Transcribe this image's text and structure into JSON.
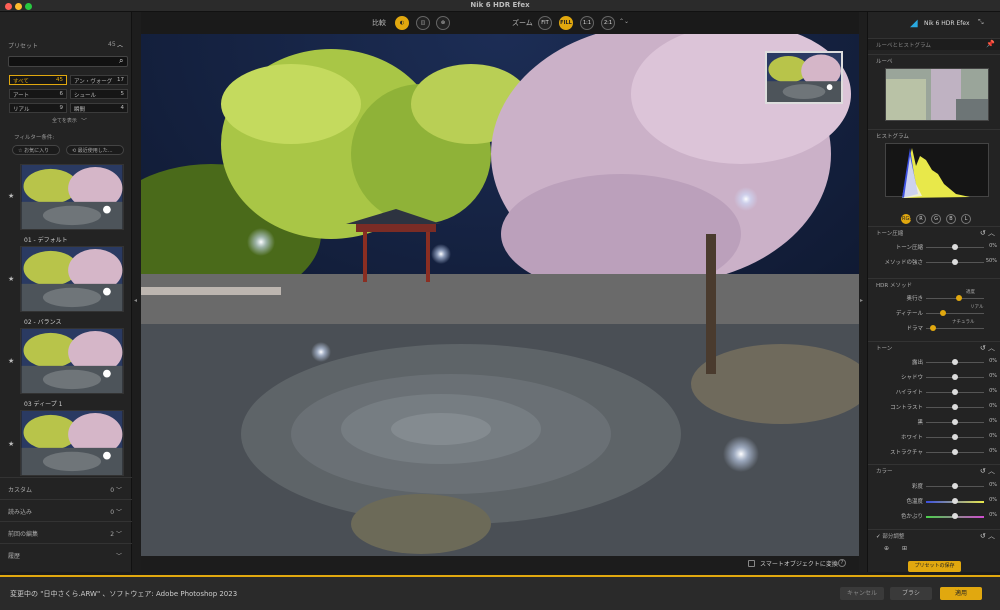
{
  "window": {
    "title": "Nik 6 HDR Efex"
  },
  "left": {
    "presets_label": "プリセット",
    "presets_count": "45",
    "categories": [
      {
        "label": "すべて",
        "count": "45",
        "sel": true
      },
      {
        "label": "アン・ヴォーグ",
        "count": "17"
      },
      {
        "label": "アート",
        "count": "6"
      },
      {
        "label": "シュール",
        "count": "5"
      },
      {
        "label": "リアル",
        "count": "9"
      },
      {
        "label": "瞬間",
        "count": "4"
      }
    ],
    "show_all": "全てを表示",
    "filter_label": "フィルター条件:",
    "favorites": "お気に入り",
    "recent": "最近使用した...",
    "thumbs": [
      {
        "label": "01 - デフォルト"
      },
      {
        "label": "02 - バランス"
      },
      {
        "label": "03 ディープ 1"
      },
      {
        "label": ""
      }
    ],
    "sections": [
      {
        "label": "カスタム",
        "count": "0"
      },
      {
        "label": "読み込み",
        "count": "0"
      },
      {
        "label": "前回の編集",
        "count": "2"
      },
      {
        "label": "履歴",
        "count": ""
      }
    ]
  },
  "topbar": {
    "compare_label": "比較",
    "zoom_label": "ズーム",
    "zoom_options": [
      "FIT",
      "FILL",
      "1:1",
      "2:1"
    ],
    "zoom_selected": "FILL"
  },
  "under": {
    "smart_object": "スマートオブジェクトに変換",
    "help": "?"
  },
  "right": {
    "product": "Nik 6 HDR Efex",
    "loupe_hist": "ルーペとヒストグラム",
    "loupe": "ルーペ",
    "histogram": "ヒストグラム",
    "channels": [
      "RGB",
      "R",
      "G",
      "B",
      "L"
    ],
    "tone_compression": "トーン圧縮",
    "tc_sliders": [
      {
        "label": "トーン圧縮",
        "value": "0%"
      },
      {
        "label": "メソッドの強さ",
        "value": "50%"
      }
    ],
    "hdr_method": "HDR メソッド",
    "hdr_sliders": [
      {
        "label": "奥行き",
        "note": "適度"
      },
      {
        "label": "ディテール",
        "note": "リアル"
      },
      {
        "label": "ドラマ",
        "note": "ナチュラル"
      }
    ],
    "tone": "トーン",
    "tone_sliders": [
      {
        "label": "露出",
        "value": "0%"
      },
      {
        "label": "シャドウ",
        "value": "0%"
      },
      {
        "label": "ハイライト",
        "value": "0%"
      },
      {
        "label": "コントラスト",
        "value": "0%"
      },
      {
        "label": "黒",
        "value": "0%"
      },
      {
        "label": "ホワイト",
        "value": "0%"
      },
      {
        "label": "ストラクチャ",
        "value": "0%"
      }
    ],
    "color": "カラー",
    "color_sliders": [
      {
        "label": "彩度",
        "value": "0%"
      },
      {
        "label": "色温度",
        "value": "0%"
      },
      {
        "label": "色かぶり",
        "value": "0%"
      }
    ],
    "local": "部分調整",
    "save_preset": "プリセットの保存"
  },
  "bottom": {
    "status": "変更中の \"日中さくら.ARW\" 、ソフトウェア: Adobe Photoshop 2023",
    "cancel": "キャンセル",
    "brush": "ブラシ",
    "apply": "適用"
  },
  "colors": {
    "accent": "#e1a80f"
  }
}
